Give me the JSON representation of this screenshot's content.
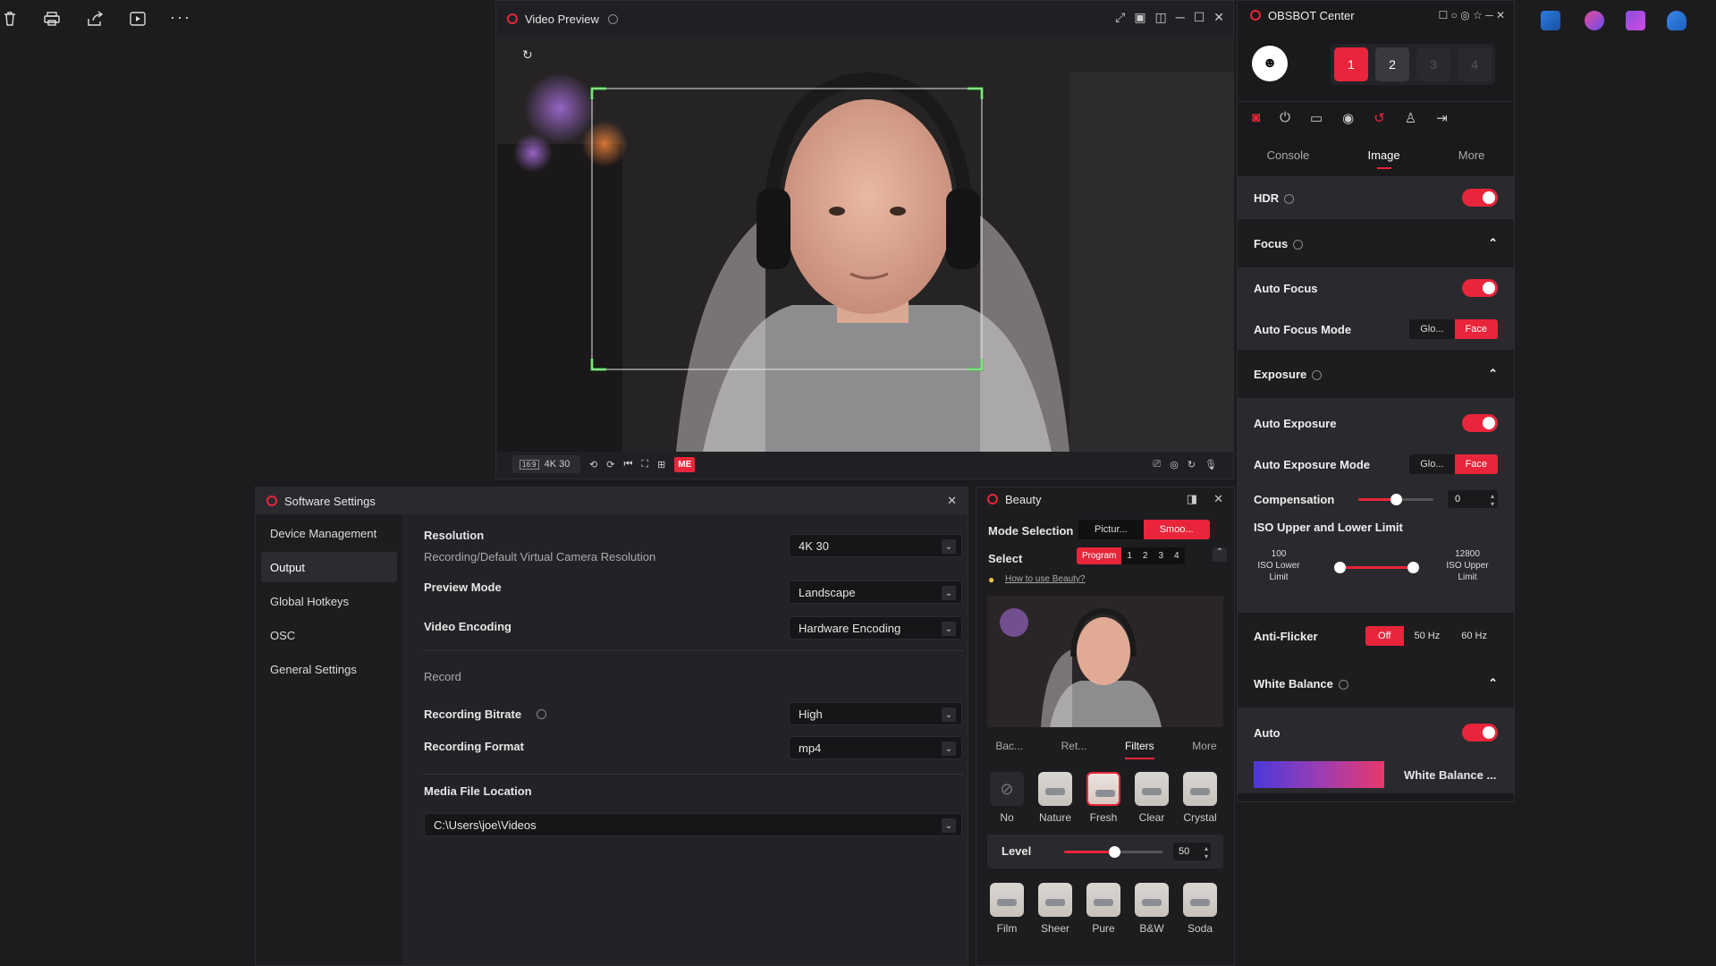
{
  "toolbar_icons": [
    "trash-icon",
    "print-icon",
    "share-icon",
    "play-icon",
    "more-icon"
  ],
  "video_preview": {
    "title": "Video Preview",
    "resolution_badge": "4K 30",
    "me_badge": "ME"
  },
  "obsbot": {
    "title": "OBSBOT Center",
    "devices": [
      "1",
      "2",
      "3",
      "4"
    ],
    "tabs": [
      "Console",
      "Image",
      "More"
    ],
    "active_tab": "Image",
    "hdr_label": "HDR",
    "focus": {
      "title": "Focus",
      "auto_focus": "Auto Focus",
      "auto_focus_mode": "Auto Focus Mode",
      "mode_options": [
        "Glo...",
        "Face"
      ]
    },
    "exposure": {
      "title": "Exposure",
      "auto_exposure": "Auto Exposure",
      "auto_exposure_mode": "Auto Exposure Mode",
      "mode_options": [
        "Glo...",
        "Face"
      ],
      "compensation": "Compensation",
      "compensation_value": "0",
      "iso_title": "ISO Upper and Lower Limit",
      "iso_lower_value": "100",
      "iso_lower_label": "ISO Lower Limit",
      "iso_upper_value": "12800",
      "iso_upper_label": "ISO Upper Limit"
    },
    "anti_flicker": {
      "label": "Anti-Flicker",
      "options": [
        "Off",
        "50 Hz",
        "60 Hz"
      ]
    },
    "white_balance": {
      "title": "White Balance",
      "auto": "Auto",
      "wb_label": "White Balance ..."
    }
  },
  "software_settings": {
    "title": "Software Settings",
    "sidebar": [
      "Device Management",
      "Output",
      "Global Hotkeys",
      "OSC",
      "General Settings"
    ],
    "active": "Output",
    "resolution_label": "Resolution",
    "resolution_sub": "Recording/Default Virtual Camera Resolution",
    "resolution_value": "4K 30",
    "preview_mode_label": "Preview Mode",
    "preview_mode_value": "Landscape",
    "video_encoding_label": "Video Encoding",
    "video_encoding_value": "Hardware Encoding",
    "record_header": "Record",
    "bitrate_label": "Recording Bitrate",
    "bitrate_value": "High",
    "format_label": "Recording Format",
    "format_value": "mp4",
    "media_label": "Media File Location",
    "media_value": "C:\\Users\\joe\\Videos"
  },
  "beauty": {
    "title": "Beauty",
    "mode_selection": "Mode Selection",
    "mode_options": [
      "Pictur...",
      "Smoo..."
    ],
    "select_label": "Select",
    "select_options": [
      "Program",
      "1",
      "2",
      "3",
      "4"
    ],
    "how_to": "How to use Beauty?",
    "tabs": [
      "Bac...",
      "Ret...",
      "Filters",
      "More"
    ],
    "active_tab": "Filters",
    "filters_row1": [
      "No",
      "Nature",
      "Fresh",
      "Clear",
      "Crystal"
    ],
    "level_label": "Level",
    "level_value": "50",
    "filters_row2": [
      "Film",
      "Sheer",
      "Pure",
      "B&W",
      "Soda"
    ]
  },
  "colors": {
    "accent": "#e8253a",
    "panel": "#2a2a2e",
    "bg": "#1c1c1e"
  }
}
